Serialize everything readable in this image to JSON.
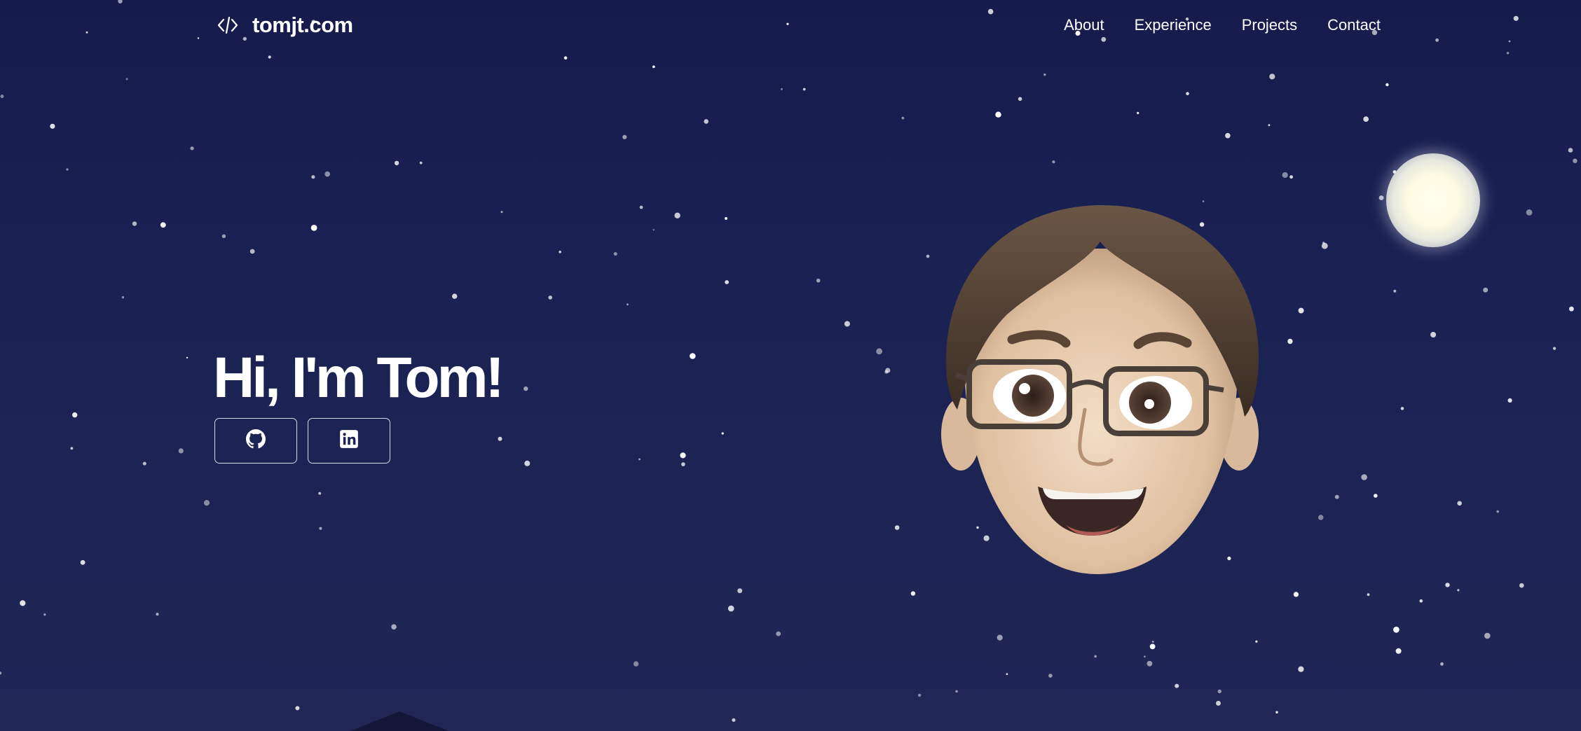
{
  "header": {
    "logo_text": "tomjt.com",
    "logo_icon": "code-icon",
    "nav": [
      {
        "label": "About"
      },
      {
        "label": "Experience"
      },
      {
        "label": "Projects"
      },
      {
        "label": "Contact"
      }
    ]
  },
  "hero": {
    "title": "Hi, I'm Tom!",
    "social": [
      {
        "icon": "github-icon"
      },
      {
        "icon": "linkedin-icon"
      }
    ],
    "avatar": "memoji-avatar"
  },
  "colors": {
    "sky_top": "#151c4c",
    "sky_bottom": "#202755",
    "text": "#ffffff",
    "moon": "#fdfbe2"
  }
}
